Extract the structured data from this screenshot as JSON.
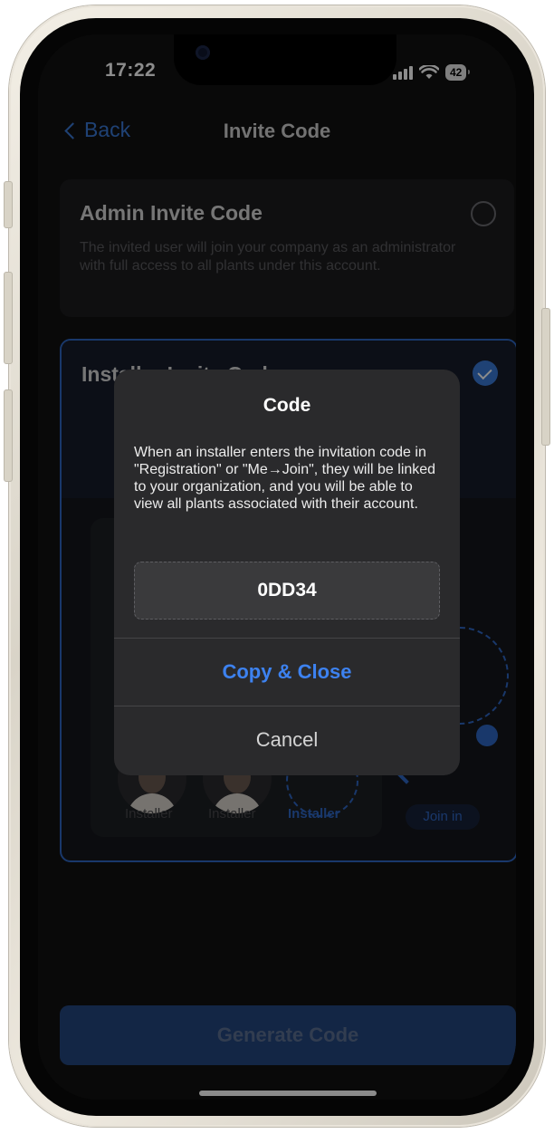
{
  "status_bar": {
    "time": "17:22",
    "battery": "42"
  },
  "nav": {
    "back_label": "Back",
    "title": "Invite Code"
  },
  "admin_card": {
    "title": "Admin Invite Code",
    "description": "The invited user will join your company as an administrator with full access to all plants under this account."
  },
  "installer_card": {
    "title": "Installer Invite Code",
    "illustration": {
      "labels": [
        "Installer",
        "Installer",
        "Installer"
      ],
      "join_label": "Join in"
    }
  },
  "dialog": {
    "title": "Code",
    "message": "When an installer enters the invitation code in \"Registration\" or \"Me→Join\", they will be linked to your organization, and you will be able to view all plants associated with their account.",
    "code": "0DD34",
    "primary_button": "Copy & Close",
    "cancel_button": "Cancel"
  },
  "footer": {
    "generate_button": "Generate Code"
  },
  "colors": {
    "accent": "#3d82f0",
    "background": "#121212",
    "dialog": "#2a2a2c"
  }
}
